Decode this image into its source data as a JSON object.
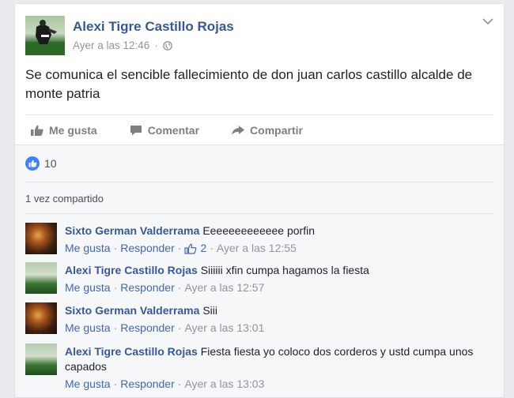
{
  "post": {
    "author": "Alexi Tigre Castillo Rojas",
    "timestamp": "Ayer a las 12:46",
    "privacy_separator": "·",
    "text": "Se comunica el sencible fallecimiento de don juan carlos castillo alcalde de monte patria"
  },
  "actions": {
    "like": "Me gusta",
    "comment": "Comentar",
    "share": "Compartir"
  },
  "reactions": {
    "count": "10"
  },
  "shares": {
    "label": "1 vez compartido"
  },
  "comments": [
    {
      "author": "Sixto German Valderrama",
      "text": "Eeeeeeeeeeeee porfin",
      "like_label": "Me gusta",
      "reply_label": "Responder",
      "likes": "2",
      "time": "Ayer a las 12:55"
    },
    {
      "author": "Alexi Tigre Castillo Rojas",
      "text": "Siiiiii xfin cumpa hagamos la fiesta",
      "like_label": "Me gusta",
      "reply_label": "Responder",
      "time": "Ayer a las 12:57"
    },
    {
      "author": "Sixto German Valderrama",
      "text": "Siii",
      "like_label": "Me gusta",
      "reply_label": "Responder",
      "time": "Ayer a las 13:01"
    },
    {
      "author": "Alexi Tigre Castillo Rojas",
      "text": "Fiesta fiesta yo coloco dos corderos y ustd cumpa unos capados",
      "like_label": "Me gusta",
      "reply_label": "Responder",
      "time": "Ayer a las 13:03"
    }
  ],
  "separator_dot": "·",
  "colors": {
    "link": "#365899",
    "muted": "#90949c",
    "like_blue": "#4080ff"
  }
}
